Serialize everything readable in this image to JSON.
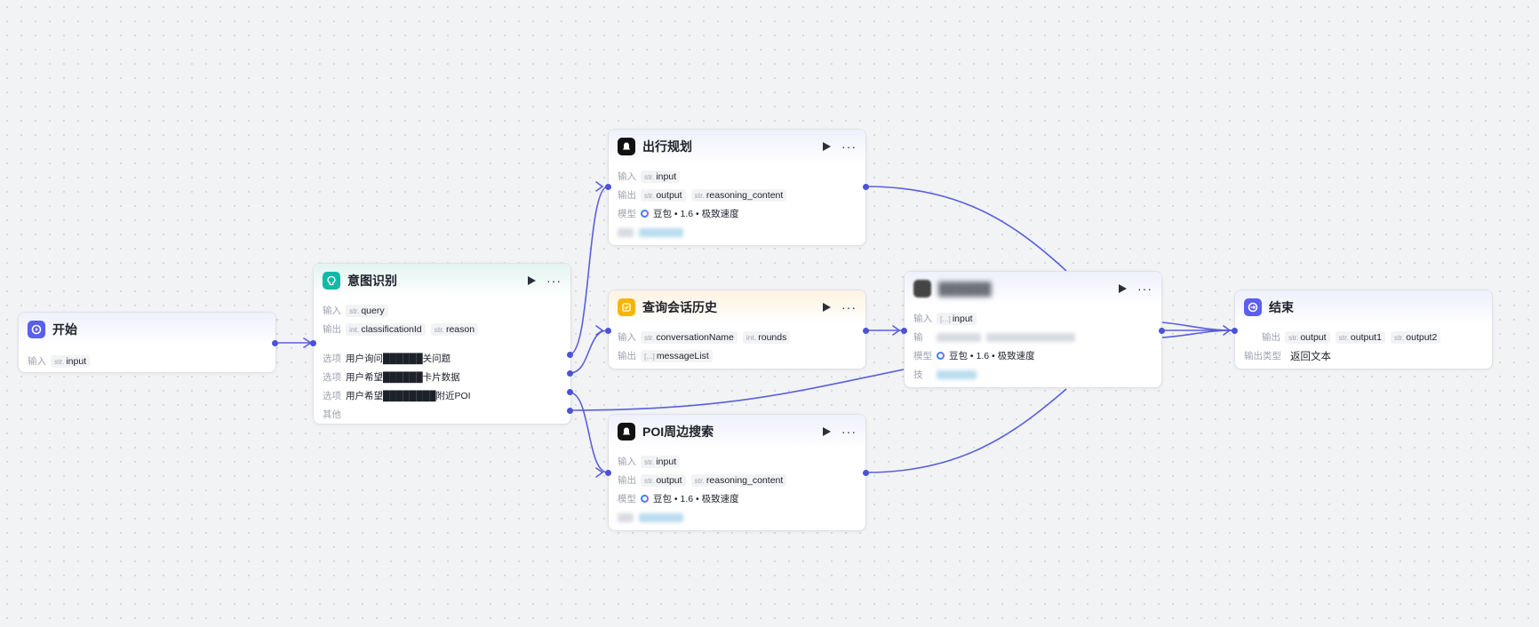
{
  "colors": {
    "edge": "#5a5fdc",
    "port": "#4b52d6",
    "start_icon": "#5b5ef0",
    "intent_icon": "#13b8a6",
    "history_icon": "#f7b500",
    "llm_icon": "#111111",
    "end_icon": "#5b5ef0"
  },
  "start": {
    "title": "开始",
    "icon": "start-icon",
    "input_label": "输入",
    "inputs": [
      {
        "type": "str.",
        "name": "input"
      }
    ]
  },
  "intent": {
    "title": "意图识别",
    "icon": "intent-icon",
    "input_label": "输入",
    "inputs": [
      {
        "type": "str.",
        "name": "query"
      }
    ],
    "output_label": "输出",
    "outputs": [
      {
        "type": "int.",
        "name": "classificationId"
      },
      {
        "type": "str.",
        "name": "reason"
      }
    ],
    "option_label": "选项",
    "options": [
      "用户询问██████关问题",
      "用户希望██████卡片数据",
      "用户希望████████附近POI"
    ],
    "other_label": "其他"
  },
  "travel": {
    "title": "出行规划",
    "icon": "llm-icon",
    "input_label": "输入",
    "inputs": [
      {
        "type": "str.",
        "name": "input"
      }
    ],
    "output_label": "输出",
    "outputs": [
      {
        "type": "str.",
        "name": "output"
      },
      {
        "type": "str.",
        "name": "reasoning_content"
      }
    ],
    "model_label": "模型",
    "model": "豆包 • 1.6 • 极致速度"
  },
  "history": {
    "title": "查询会话历史",
    "icon": "history-icon",
    "input_label": "输入",
    "inputs": [
      {
        "type": "str.",
        "name": "conversationName"
      },
      {
        "type": "int.",
        "name": "rounds"
      }
    ],
    "output_label": "输出",
    "outputs": [
      {
        "type": "[...]",
        "name": "messageList"
      }
    ]
  },
  "poi": {
    "title": "POI周边搜索",
    "icon": "llm-icon",
    "input_label": "输入",
    "inputs": [
      {
        "type": "str.",
        "name": "input"
      }
    ],
    "output_label": "输出",
    "outputs": [
      {
        "type": "str.",
        "name": "output"
      },
      {
        "type": "str.",
        "name": "reasoning_content"
      }
    ],
    "model_label": "模型",
    "model": "豆包 • 1.6 • 极致速度"
  },
  "middle": {
    "title": "██████",
    "icon": "llm-icon",
    "input_label": "输入",
    "inputs": [
      {
        "type": "[...]",
        "name": "input"
      }
    ],
    "output_label": "输",
    "model_label": "模型",
    "model": "豆包 • 1.6 • 极致速度",
    "skill_label": "技"
  },
  "end": {
    "title": "结束",
    "icon": "end-icon",
    "output_label": "输出",
    "outputs": [
      {
        "type": "str.",
        "name": "output"
      },
      {
        "type": "str.",
        "name": "output1"
      },
      {
        "type": "str.",
        "name": "output2"
      }
    ],
    "output_type_label": "输出类型",
    "output_type": "返回文本"
  }
}
